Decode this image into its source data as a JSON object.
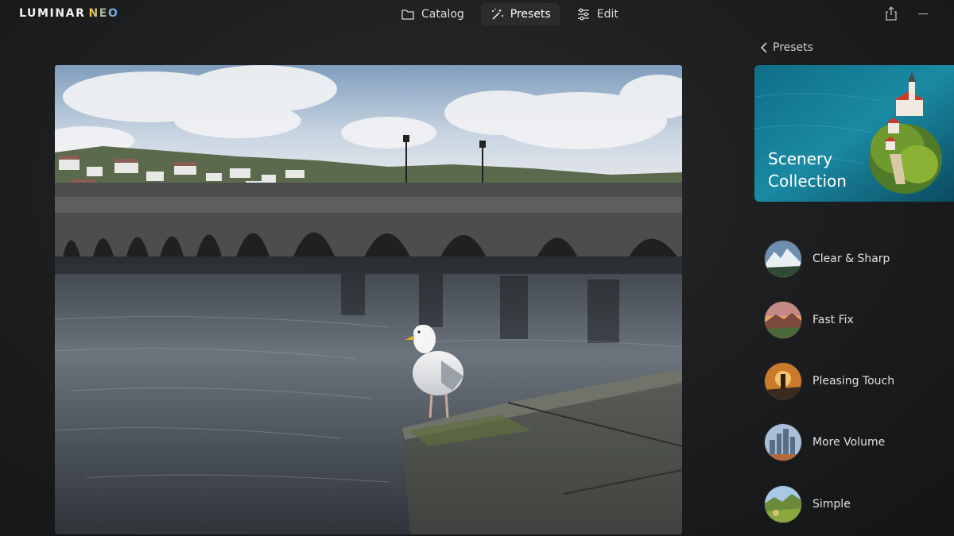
{
  "app": {
    "logo_main": "LUMINAR",
    "logo_accent": "NEO"
  },
  "nav": {
    "catalog": "Catalog",
    "presets": "Presets",
    "edit": "Edit"
  },
  "panel": {
    "back_label": "Presets",
    "collection_title_line1": "Scenery",
    "collection_title_line2": "Collection",
    "presets": [
      {
        "label": "Clear & Sharp"
      },
      {
        "label": "Fast Fix"
      },
      {
        "label": "Pleasing Touch"
      },
      {
        "label": "More Volume"
      },
      {
        "label": "Simple"
      }
    ]
  },
  "icons": {
    "catalog": "folder-icon",
    "presets": "magic-wand-icon",
    "edit": "sliders-icon",
    "share": "share-icon",
    "minimize": "minimize-icon",
    "back": "chevron-left-icon"
  },
  "colors": {
    "background": "#1c1d1f",
    "active_tab": "#2b2c2e",
    "accent_yellow": "#f5c542",
    "accent_blue": "#5aa6ff"
  }
}
